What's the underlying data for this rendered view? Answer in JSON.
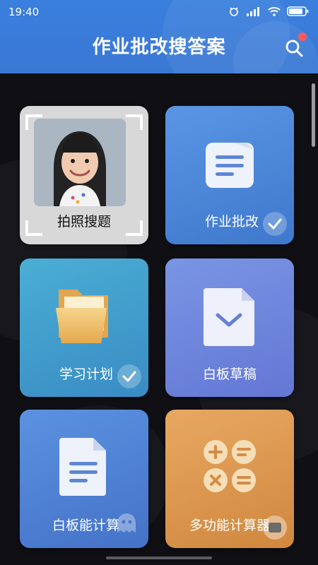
{
  "status": {
    "time": "19:40",
    "battery": "80"
  },
  "header": {
    "title": "作业批改搜答案"
  },
  "cards": [
    {
      "label": "拍照搜题",
      "icon": "camera-photo-icon"
    },
    {
      "label": "作业批改",
      "icon": "document-lines-icon",
      "checked": true
    },
    {
      "label": "学习计划",
      "icon": "folder-icon",
      "checked": true
    },
    {
      "label": "白板草稿",
      "icon": "paper-chevron-icon"
    },
    {
      "label": "白板能计算",
      "icon": "document-lines-icon"
    },
    {
      "label": "多功能计算器",
      "icon": "calculator-icon"
    }
  ],
  "colors": {
    "header": "#3a7fdd",
    "card_homework": "#4a86d8",
    "card_plan": "#3f98c8",
    "card_whiteboard": "#6e86dc",
    "card_calc_whiteboard": "#4d7fd2",
    "card_calculator": "#dd9a54"
  }
}
